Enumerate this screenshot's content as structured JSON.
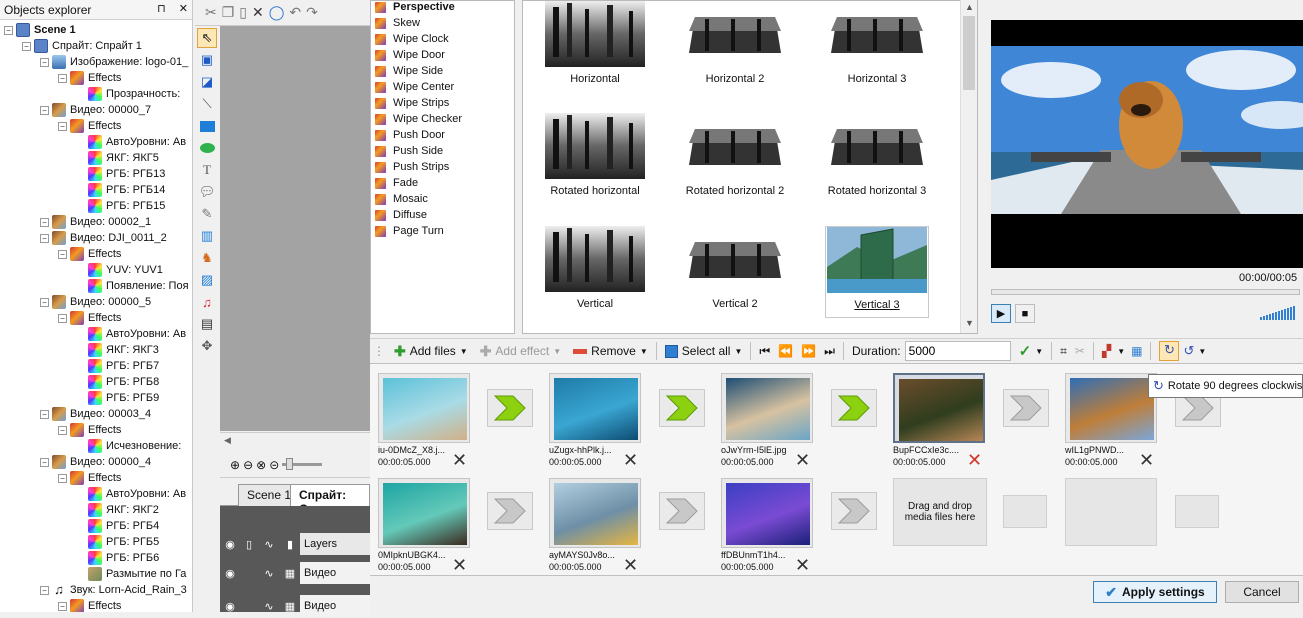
{
  "explorer": {
    "title": "Objects explorer",
    "pin": "⊓",
    "close": "✕",
    "rows": [
      {
        "label": "Scene 1",
        "icon": "scene-icon",
        "level": 0,
        "bold": true
      },
      {
        "label": "Спрайт: Спрайт 1",
        "icon": "sprite-icon",
        "level": 1
      },
      {
        "label": "Изображение: logo-01_",
        "icon": "image-icon",
        "level": 2
      },
      {
        "label": "Effects",
        "icon": "effects-icon",
        "level": 3
      },
      {
        "label": "Прозрачность:",
        "icon": "color-effect-icon",
        "level": 4
      },
      {
        "label": "Видео: 00000_7",
        "icon": "video-icon",
        "level": 2
      },
      {
        "label": "Effects",
        "icon": "effects-icon",
        "level": 3
      },
      {
        "label": "АвтоУровни: Ав",
        "icon": "color-effect-icon",
        "level": 4
      },
      {
        "label": "ЯКГ: ЯКГ5",
        "icon": "color-effect-icon",
        "level": 4
      },
      {
        "label": "РГБ: РГБ13",
        "icon": "color-effect-icon",
        "level": 4
      },
      {
        "label": "РГБ: РГБ14",
        "icon": "color-effect-icon",
        "level": 4
      },
      {
        "label": "РГБ: РГБ15",
        "icon": "color-effect-icon",
        "level": 4
      },
      {
        "label": "Видео: 00002_1",
        "icon": "video-icon",
        "level": 2
      },
      {
        "label": "Видео: DJI_0011_2",
        "icon": "video-icon",
        "level": 2
      },
      {
        "label": "Effects",
        "icon": "effects-icon",
        "level": 3
      },
      {
        "label": "YUV: YUV1",
        "icon": "color-effect-icon",
        "level": 4
      },
      {
        "label": "Появление: Поя",
        "icon": "color-effect-icon",
        "level": 4
      },
      {
        "label": "Видео: 00000_5",
        "icon": "video-icon",
        "level": 2
      },
      {
        "label": "Effects",
        "icon": "effects-icon",
        "level": 3
      },
      {
        "label": "АвтоУровни: Ав",
        "icon": "color-effect-icon",
        "level": 4
      },
      {
        "label": "ЯКГ: ЯКГ3",
        "icon": "color-effect-icon",
        "level": 4
      },
      {
        "label": "РГБ: РГБ7",
        "icon": "color-effect-icon",
        "level": 4
      },
      {
        "label": "РГБ: РГБ8",
        "icon": "color-effect-icon",
        "level": 4
      },
      {
        "label": "РГБ: РГБ9",
        "icon": "color-effect-icon",
        "level": 4
      },
      {
        "label": "Видео: 00003_4",
        "icon": "video-icon",
        "level": 2
      },
      {
        "label": "Effects",
        "icon": "effects-icon",
        "level": 3
      },
      {
        "label": "Исчезновение:",
        "icon": "color-effect-icon",
        "level": 4
      },
      {
        "label": "Видео: 00000_4",
        "icon": "video-icon",
        "level": 2
      },
      {
        "label": "Effects",
        "icon": "effects-icon",
        "level": 3
      },
      {
        "label": "АвтоУровни: Ав",
        "icon": "color-effect-icon",
        "level": 4
      },
      {
        "label": "ЯКГ: ЯКГ2",
        "icon": "color-effect-icon",
        "level": 4
      },
      {
        "label": "РГБ: РГБ4",
        "icon": "color-effect-icon",
        "level": 4
      },
      {
        "label": "РГБ: РГБ5",
        "icon": "color-effect-icon",
        "level": 4
      },
      {
        "label": "РГБ: РГБ6",
        "icon": "color-effect-icon",
        "level": 4
      },
      {
        "label": "Размытие по Га",
        "icon": "blur-icon",
        "level": 4
      },
      {
        "label": "Звук: Lorn-Acid_Rain_3",
        "icon": "sound-icon",
        "level": 2
      },
      {
        "label": "Effects",
        "icon": "effects-icon",
        "level": 3
      }
    ]
  },
  "timeline": {
    "tabs": [
      "Scene 1",
      "Спрайт: Спра"
    ],
    "layers_header": "Layers",
    "layers": [
      "Видео",
      "Видео"
    ]
  },
  "transitions": {
    "items": [
      "Perspective",
      "Skew",
      "Wipe Clock",
      "Wipe Door",
      "Wipe Side",
      "Wipe Center",
      "Wipe Strips",
      "Wipe Checker",
      "Push Door",
      "Push Side",
      "Push Strips",
      "Fade",
      "Mosaic",
      "Diffuse",
      "Page Turn"
    ],
    "selected": "Perspective"
  },
  "thumbs": [
    {
      "label": "Horizontal",
      "style": "flat"
    },
    {
      "label": "Horizontal 2",
      "style": "tilt"
    },
    {
      "label": "Horizontal 3",
      "style": "tilt"
    },
    {
      "label": "Rotated horizontal",
      "style": "flat"
    },
    {
      "label": "Rotated horizontal 2",
      "style": "tilt"
    },
    {
      "label": "Rotated horizontal 3",
      "style": "tilt"
    },
    {
      "label": "Vertical",
      "style": "flat"
    },
    {
      "label": "Vertical 2",
      "style": "tilt"
    },
    {
      "label": "Vertical 3",
      "style": "color",
      "selected": true
    }
  ],
  "preview": {
    "time": "00:00/00:05"
  },
  "toolbar": {
    "add_files": "Add files",
    "add_effect": "Add effect",
    "remove": "Remove",
    "select_all": "Select all",
    "duration_label": "Duration:",
    "duration_value": "5000"
  },
  "media": {
    "row1": [
      {
        "name": "iu-0DMcZ_X8.j...",
        "time": "00:00:05.000",
        "colors": [
          "#5cc1d9",
          "#a9dbe6",
          "#d0b087"
        ]
      },
      {
        "name": "uZugx-hhPlk.j...",
        "time": "00:00:05.000",
        "colors": [
          "#1f7ba8",
          "#3aa6d2",
          "#0d4c72"
        ]
      },
      {
        "name": "oJwYrm-I5lE.jpg",
        "time": "00:00:05.000",
        "colors": [
          "#1d4e74",
          "#d7c2a1",
          "#6aa5c6"
        ]
      },
      {
        "name": "BupFCCxIe3c....",
        "time": "00:00:05.000",
        "colors": [
          "#6b4d2b",
          "#2f3d1e",
          "#b68656"
        ],
        "active": true
      },
      {
        "name": "wIL1gPNWD...",
        "time": "00:00:05.000",
        "colors": [
          "#2f6eb5",
          "#bf7e39",
          "#7aa6d9"
        ]
      }
    ],
    "row2": [
      {
        "name": "0MIpknUBGK4...",
        "time": "00:00:05.000",
        "colors": [
          "#1da5a3",
          "#64c9b9",
          "#3b2a1f"
        ]
      },
      {
        "name": "ayMAYS0Jv8o...",
        "time": "00:00:05.000",
        "colors": [
          "#b2cfe0",
          "#6e8fa6",
          "#e6b541"
        ]
      },
      {
        "name": "ffDBUnmT1h4...",
        "time": "00:00:05.000",
        "colors": [
          "#3b3fc4",
          "#7a4bd3",
          "#1b2078"
        ]
      }
    ],
    "drop_text": "Drag and drop media files here"
  },
  "tooltip": "Rotate 90 degrees clockwise",
  "buttons": {
    "apply": "Apply settings",
    "cancel": "Cancel"
  }
}
